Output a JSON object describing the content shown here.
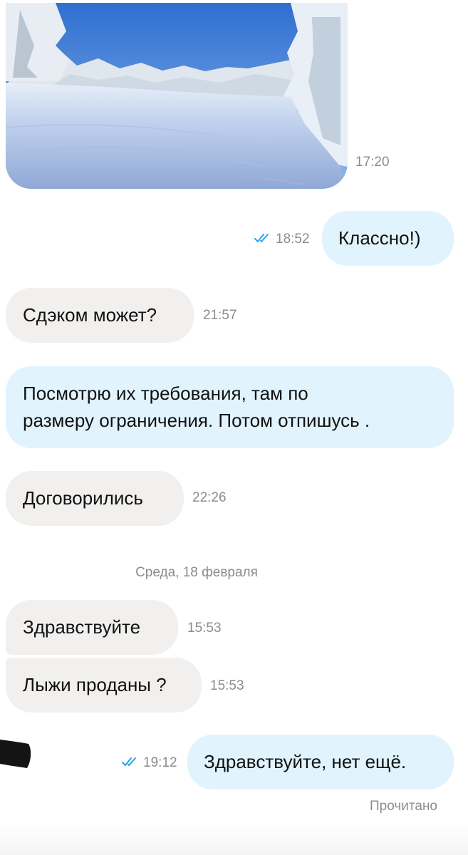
{
  "messages": [
    {
      "type": "photo",
      "direction": "in",
      "time": "17:20",
      "icon": "winter-landscape-photo"
    },
    {
      "type": "text",
      "direction": "out",
      "text": "Классно!)",
      "time": "18:52",
      "status_icon": "double-check-icon"
    },
    {
      "type": "text",
      "direction": "in",
      "text": "Сдэком может?",
      "time": "21:57"
    },
    {
      "type": "text",
      "direction": "out",
      "lines": [
        "Посмотрю их требования, там по",
        "размеру ограничения. Потом отпишусь ."
      ]
    },
    {
      "type": "text",
      "direction": "in",
      "text": "Договорились",
      "time": "22:26"
    },
    {
      "type": "text",
      "direction": "in",
      "text": "Здравствуйте",
      "time": "15:53"
    },
    {
      "type": "text",
      "direction": "in",
      "text": "Лыжи проданы ?",
      "time": "15:53"
    },
    {
      "type": "text",
      "direction": "out",
      "text": "Здравствуйте, нет ещё.",
      "time": "19:12",
      "status_icon": "double-check-icon"
    }
  ],
  "date_separator": "Среда, 18 февраля",
  "read_status": "Прочитано",
  "colors": {
    "incoming_bubble": "#f1f0ee",
    "outgoing_bubble": "#e1f3fd",
    "check_icon": "#2aa4e6",
    "meta_text": "#8c8c8c"
  }
}
